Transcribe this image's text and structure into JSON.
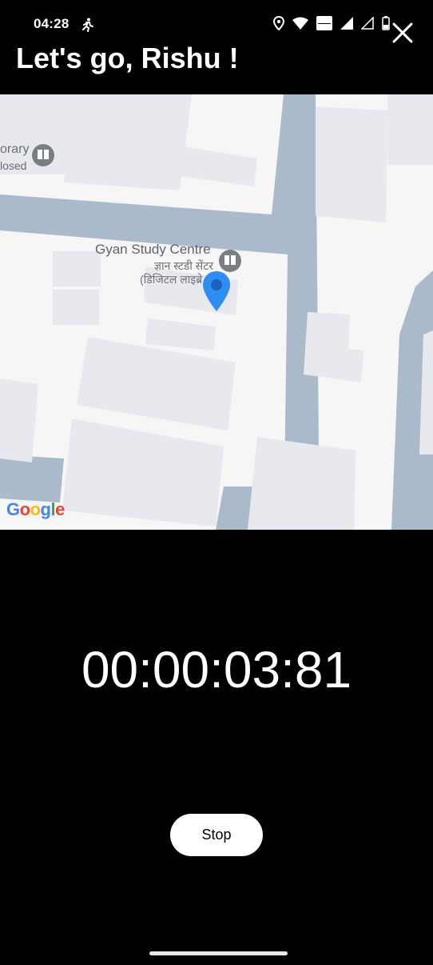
{
  "status_bar": {
    "time": "04:28",
    "icons": [
      "running-activity-icon",
      "location-icon",
      "wifi-icon",
      "volte-wifi-icon",
      "signal-icon",
      "signal-icon-2",
      "battery-icon"
    ]
  },
  "header": {
    "title": "Let's go, Rishu !",
    "close_icon": "close-icon"
  },
  "map": {
    "place_name": "Gyan Study Centre",
    "place_name_hindi": "ज्ञान स्टडी सेंटर",
    "place_sub_hindi": "(डिजिटल लाइब्रे",
    "library_partial": "orary",
    "closed_partial": "losed",
    "attribution": "Google",
    "colors": {
      "road": "#a9b8c8",
      "building": "#e8e9ee",
      "pin": "#2d8df0"
    }
  },
  "timer": {
    "elapsed": "00:00:03:81"
  },
  "controls": {
    "stop_label": "Stop"
  }
}
